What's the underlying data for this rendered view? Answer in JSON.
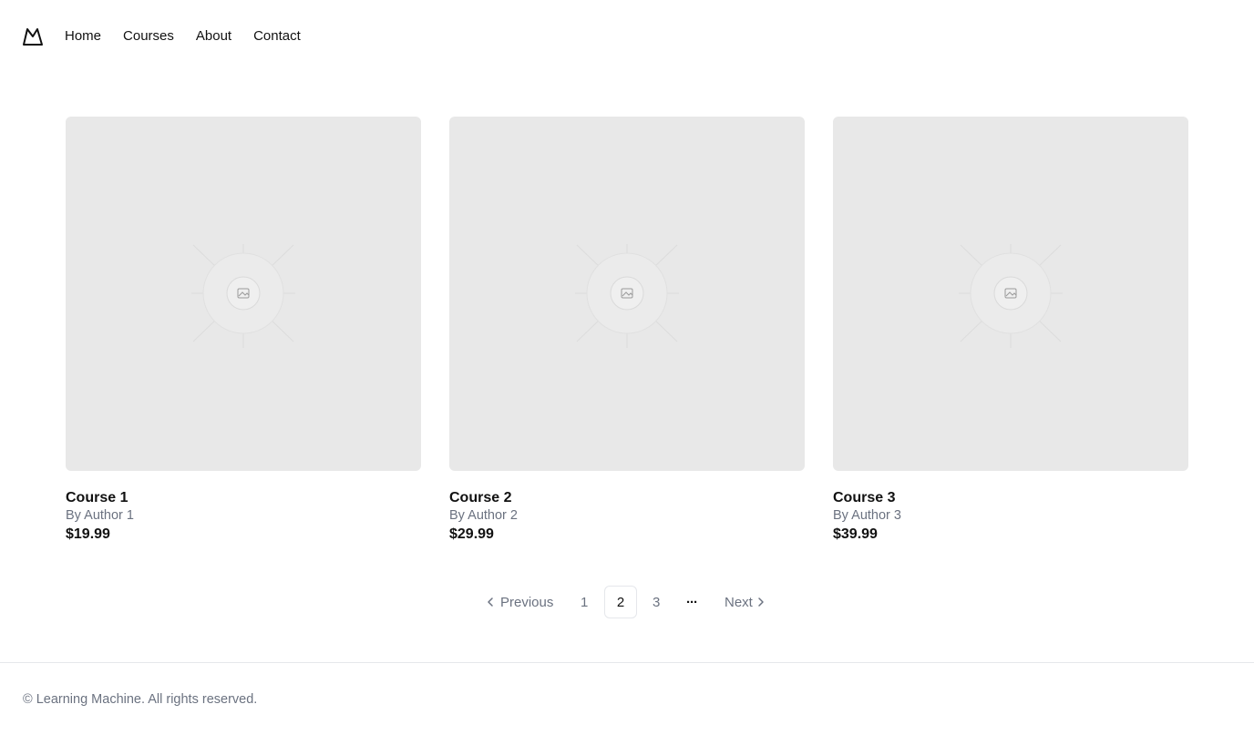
{
  "header": {
    "logo_icon": "mountain-logo-icon",
    "nav": [
      {
        "label": "Home"
      },
      {
        "label": "Courses"
      },
      {
        "label": "About"
      },
      {
        "label": "Contact"
      }
    ]
  },
  "courses": [
    {
      "title": "Course 1",
      "author": "By Author 1",
      "price": "$19.99",
      "image_icon": "image-placeholder-icon"
    },
    {
      "title": "Course 2",
      "author": "By Author 2",
      "price": "$29.99",
      "image_icon": "image-placeholder-icon"
    },
    {
      "title": "Course 3",
      "author": "By Author 3",
      "price": "$39.99",
      "image_icon": "image-placeholder-icon"
    }
  ],
  "pagination": {
    "previous_label": "Previous",
    "next_label": "Next",
    "pages": [
      "1",
      "2",
      "3"
    ],
    "current_page": "2",
    "ellipsis": "···"
  },
  "footer": {
    "copyright": "© Learning Machine. All rights reserved."
  },
  "colors": {
    "placeholder_bg": "#e8e8e8",
    "muted_text": "#6b7280",
    "border": "#e5e7eb"
  }
}
